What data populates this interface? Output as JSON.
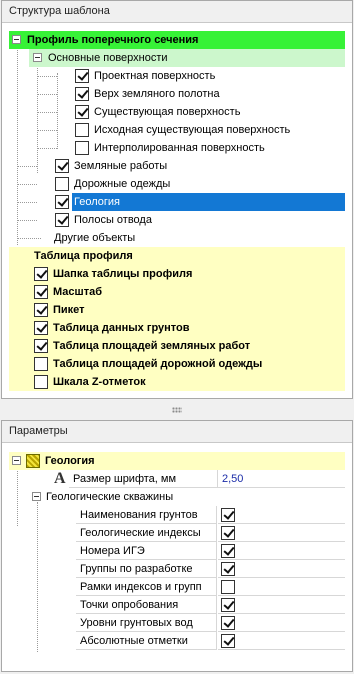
{
  "template_panel": {
    "title": "Структура шаблона",
    "items": [
      {
        "label": "Профиль поперечного сечения"
      },
      {
        "label": "Основные поверхности"
      },
      {
        "label": "Проектная поверхность",
        "checked": true
      },
      {
        "label": "Верх земляного полотна",
        "checked": true
      },
      {
        "label": "Существующая поверхность",
        "checked": true
      },
      {
        "label": "Исходная существующая поверхность",
        "checked": false
      },
      {
        "label": "Интерполированная поверхность",
        "checked": false
      },
      {
        "label": "Земляные работы",
        "checked": true
      },
      {
        "label": "Дорожные одежды",
        "checked": false
      },
      {
        "label": "Геология",
        "checked": true
      },
      {
        "label": "Полосы отвода",
        "checked": true
      },
      {
        "label": "Другие объекты"
      },
      {
        "label": "Таблица профиля"
      },
      {
        "label": "Шапка таблицы профиля",
        "checked": true
      },
      {
        "label": "Масштаб",
        "checked": true
      },
      {
        "label": "Пикет",
        "checked": true
      },
      {
        "label": "Таблица данных грунтов",
        "checked": true
      },
      {
        "label": "Таблица площадей земляных работ",
        "checked": true
      },
      {
        "label": "Таблица площадей дорожной одежды",
        "checked": false
      },
      {
        "label": "Шкала Z-отметок",
        "checked": false
      }
    ]
  },
  "params_panel": {
    "title": "Параметры",
    "group": "Геология",
    "font_size_label": "Размер шрифта, мм",
    "font_size_value": "2,50",
    "boreholes_label": "Геологические скважины",
    "props": [
      {
        "label": "Наименования грунтов",
        "checked": true
      },
      {
        "label": "Геологические индексы",
        "checked": true
      },
      {
        "label": "Номера ИГЭ",
        "checked": true
      },
      {
        "label": "Группы по разработке",
        "checked": true
      },
      {
        "label": "Рамки индексов и групп",
        "checked": false
      },
      {
        "label": "Точки опробования",
        "checked": true
      },
      {
        "label": "Уровни грунтовых вод",
        "checked": true
      },
      {
        "label": "Абсолютные отметки",
        "checked": true
      }
    ]
  },
  "icons": {
    "expander": "collapse-minus-icon",
    "group_icon": "geology-pattern-icon",
    "font_icon": "font-size-icon",
    "splitter": "splitter-grip-icon"
  },
  "colors": {
    "root_highlight": "#37f237",
    "surfaces_highlight": "#ccf7cc",
    "table_highlight": "#ffffc2",
    "selection": "#1378d4",
    "value_text": "#1b2ca8"
  }
}
